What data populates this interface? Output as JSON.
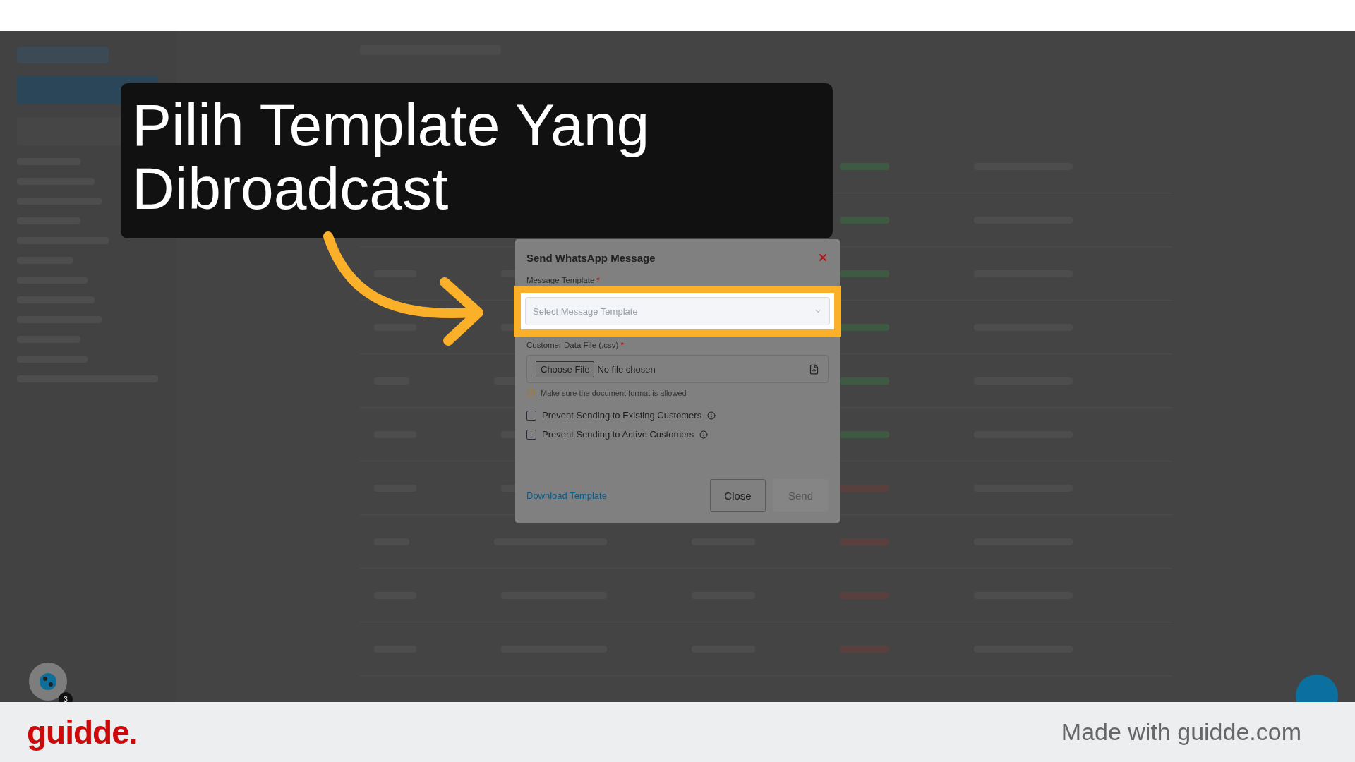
{
  "callout": {
    "title": "Pilih Template Yang Dibroadcast"
  },
  "modal": {
    "title": "Send WhatsApp Message",
    "fields": [
      {
        "kind": "select",
        "label": "Message Template",
        "required_mark": "*",
        "placeholder": "Select Message Template",
        "highlighted": true
      },
      {
        "kind": "file",
        "label": "Customer Data File (.csv)",
        "required_mark": "*",
        "button": "Choose File",
        "value": "No file chosen",
        "hint": "Make sure the document format is allowed",
        "highlighted": false
      }
    ],
    "options": [
      {
        "label": "Prevent Sending to Existing Customers",
        "checked": false
      },
      {
        "label": "Prevent Sending to Active Customers",
        "checked": false
      }
    ],
    "link": "Download Template",
    "buttons": [
      {
        "label": "Close",
        "disabled": false
      },
      {
        "label": "Send",
        "disabled": true
      }
    ]
  },
  "help_widget": {
    "badge": "3"
  },
  "footer": {
    "logo": "guidde.",
    "credit": "Made with guidde.com"
  }
}
